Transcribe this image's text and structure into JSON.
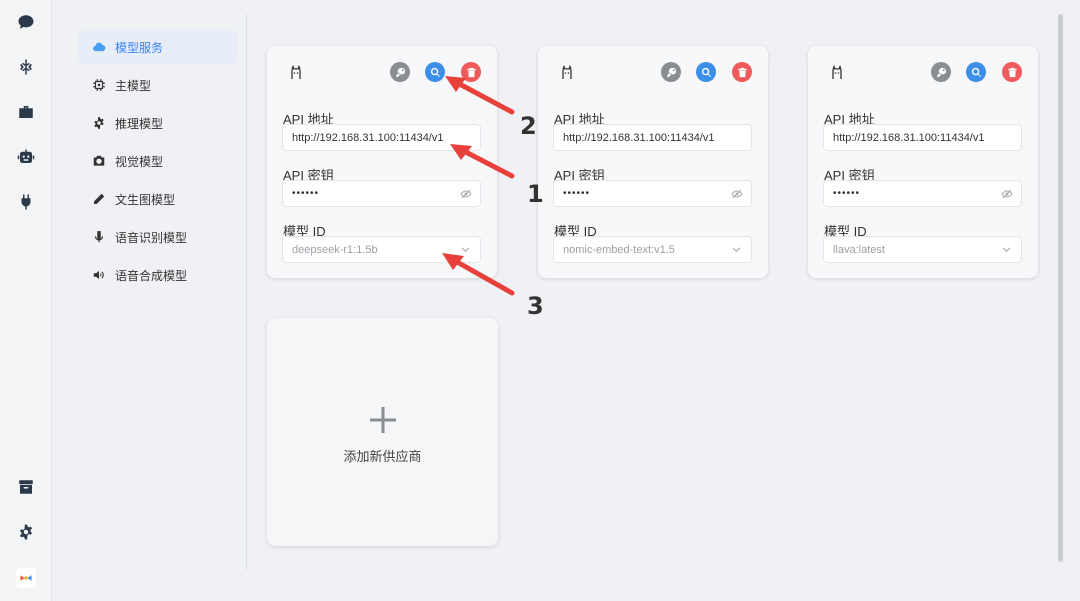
{
  "rail": {
    "items": [
      {
        "icon": "chat-icon"
      },
      {
        "icon": "snowflake-icon"
      },
      {
        "icon": "toolbox-icon"
      },
      {
        "icon": "robot-icon"
      },
      {
        "icon": "plug-icon"
      }
    ],
    "bottom": [
      {
        "icon": "archive-icon"
      },
      {
        "icon": "gear-icon"
      },
      {
        "icon": "app-logo-icon"
      }
    ]
  },
  "menu": {
    "items": [
      {
        "label": "模型服务",
        "icon": "cloud-icon",
        "active": true
      },
      {
        "label": "主模型",
        "icon": "chip-icon"
      },
      {
        "label": "推理模型",
        "icon": "cog-icon"
      },
      {
        "label": "视觉模型",
        "icon": "camera-icon"
      },
      {
        "label": "文生图模型",
        "icon": "pencil-icon"
      },
      {
        "label": "语音识别模型",
        "icon": "microphone-icon"
      },
      {
        "label": "语音合成模型",
        "icon": "speaker-icon"
      }
    ]
  },
  "cards": [
    {
      "api_label": "API 地址",
      "api_url": "http://192.168.31.100:11434/v1",
      "key_label": "API 密钥",
      "key_value": "••••••",
      "model_label": "模型 ID",
      "model_value": "deepseek-r1:1.5b"
    },
    {
      "api_label": "API 地址",
      "api_url": "http://192.168.31.100:11434/v1",
      "key_label": "API 密钥",
      "key_value": "••••••",
      "model_label": "模型 ID",
      "model_value": "nomic-embed-text:v1.5"
    },
    {
      "api_label": "API 地址",
      "api_url": "http://192.168.31.100:11434/v1",
      "key_label": "API 密钥",
      "key_value": "••••••",
      "model_label": "模型 ID",
      "model_value": "llava:latest"
    }
  ],
  "add_card": {
    "label": "添加新供应商"
  },
  "annotations": {
    "n1": "1",
    "n2": "2",
    "n3": "3",
    "arrow_color": "#e8403a"
  },
  "colors": {
    "accent": "#3d8ee8",
    "danger": "#ef5b5b",
    "muted": "#8a8d92"
  }
}
